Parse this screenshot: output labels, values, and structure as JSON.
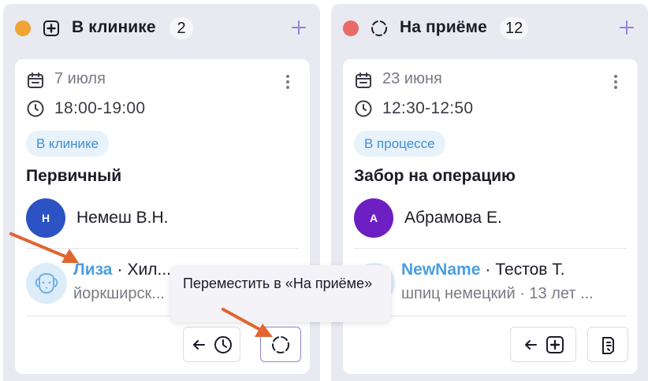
{
  "columns": [
    {
      "title": "В клинике",
      "count": "2",
      "status_color": "#f0a434",
      "header_icon": "medical-cross-icon",
      "card": {
        "date": "7 июля",
        "time": "18:00-19:00",
        "status_chip": "В клинике",
        "visit_type": "Первичный",
        "doctor": {
          "initial": "Н",
          "name": "Немеш В.Н.",
          "avatar_color": "#2c52c4"
        },
        "pet": {
          "name": "Лиза",
          "owner": "Хил...",
          "breed": "йоркширск..."
        },
        "actions": [
          "back-to-scheduled",
          "move-to-reception"
        ]
      }
    },
    {
      "title": "На приёме",
      "count": "12",
      "status_color": "#e96a6a",
      "header_icon": "in-progress-icon",
      "card": {
        "date": "23 июня",
        "time": "12:30-12:50",
        "status_chip": "В процессе",
        "visit_type": "Забор на операцию",
        "doctor": {
          "initial": "А",
          "name": "Абрамова Е.",
          "avatar_color": "#6d1fc4"
        },
        "pet": {
          "name": "NewName",
          "owner": "Тестов Т.",
          "breed": "шпиц немецкий · 13 лет ..."
        },
        "actions": [
          "back-to-clinic",
          "discharge"
        ]
      }
    }
  ],
  "tooltip": {
    "text": "Переместить в «На приёме»"
  },
  "accent": "#8d86d8",
  "annotation_color": "#e0652f"
}
